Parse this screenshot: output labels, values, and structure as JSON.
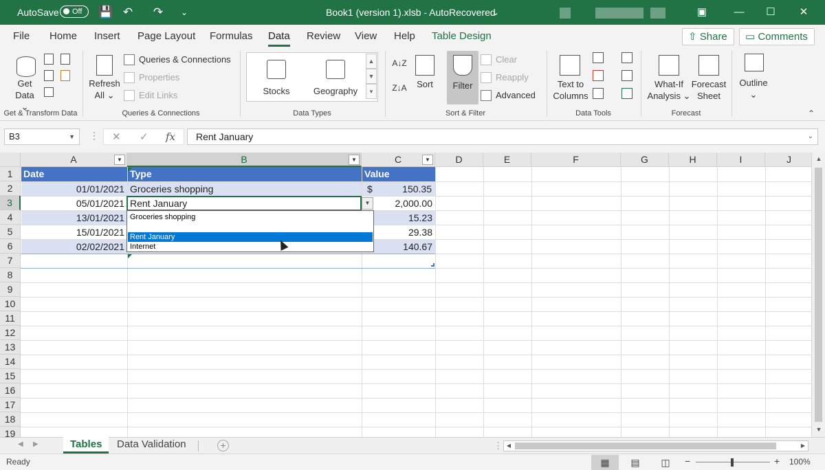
{
  "titlebar": {
    "autosave_label": "AutoSave",
    "autosave_state": "Off",
    "doc_title": "Book1 (version 1).xlsb  -  AutoRecovered",
    "title_chevron": "⌄",
    "save_icon": "💾",
    "undo_icon": "↶",
    "redo_icon": "↷",
    "qat_icon": "⌄",
    "ribbon_display_icon": "▣",
    "minimize": "—",
    "maximize": "☐",
    "close": "✕"
  },
  "tabs": [
    "File",
    "Home",
    "Insert",
    "Page Layout",
    "Formulas",
    "Data",
    "Review",
    "View",
    "Help",
    "Table Design"
  ],
  "share_label": "Share",
  "comments_label": "Comments",
  "ribbon": {
    "get_data_1": "Get",
    "get_data_2": "Data ⌄",
    "group_get_transform": "Get & Transform Data",
    "refresh_1": "Refresh",
    "refresh_2": "All ⌄",
    "queries_connections": "Queries & Connections",
    "properties": "Properties",
    "edit_links": "Edit Links",
    "group_queries": "Queries & Connections",
    "stocks": "Stocks",
    "geography": "Geography",
    "group_data_types": "Data Types",
    "sort": "Sort",
    "filter": "Filter",
    "clear": "Clear",
    "reapply": "Reapply",
    "advanced": "Advanced",
    "group_sort_filter": "Sort & Filter",
    "text_to_1": "Text to",
    "text_to_2": "Columns",
    "group_data_tools": "Data Tools",
    "whatif_1": "What-If",
    "whatif_2": "Analysis ⌄",
    "forecast_1": "Forecast",
    "forecast_2": "Sheet",
    "group_forecast": "Forecast",
    "outline": "Outline",
    "outline_chevron": "⌄",
    "collapse": "⌃"
  },
  "formula_bar": {
    "name_box": "B3",
    "fx": "fx",
    "cancel": "✕",
    "enter": "✓",
    "value": "Rent January"
  },
  "columns": [
    "A",
    "B",
    "C",
    "D",
    "E",
    "F",
    "G",
    "H",
    "I",
    "J"
  ],
  "rows": [
    "1",
    "2",
    "3",
    "4",
    "5",
    "6",
    "7",
    "8",
    "9",
    "10",
    "11",
    "12",
    "13",
    "14",
    "15",
    "16",
    "17",
    "18",
    "19"
  ],
  "table": {
    "headers": [
      "Date",
      "Type",
      "Value"
    ],
    "rows": [
      {
        "date": "01/01/2021",
        "type": "Groceries shopping",
        "currency": "$",
        "value": "150.35"
      },
      {
        "date": "05/01/2021",
        "type": "Rent January",
        "value": "2,000.00"
      },
      {
        "date": "13/01/2021",
        "value": "15.23"
      },
      {
        "date": "15/01/2021",
        "value": "29.38"
      },
      {
        "date": "02/02/2021",
        "value": "140.67"
      }
    ]
  },
  "dropdown": {
    "options": [
      "Groceries shopping",
      "",
      "Rent January",
      "Internet"
    ],
    "selected": "Rent January"
  },
  "sheets": [
    "Tables",
    "Data Validation"
  ],
  "active_sheet": "Tables",
  "status": {
    "ready": "Ready",
    "zoom": "100%",
    "zoom_minus": "−",
    "zoom_plus": "+"
  }
}
